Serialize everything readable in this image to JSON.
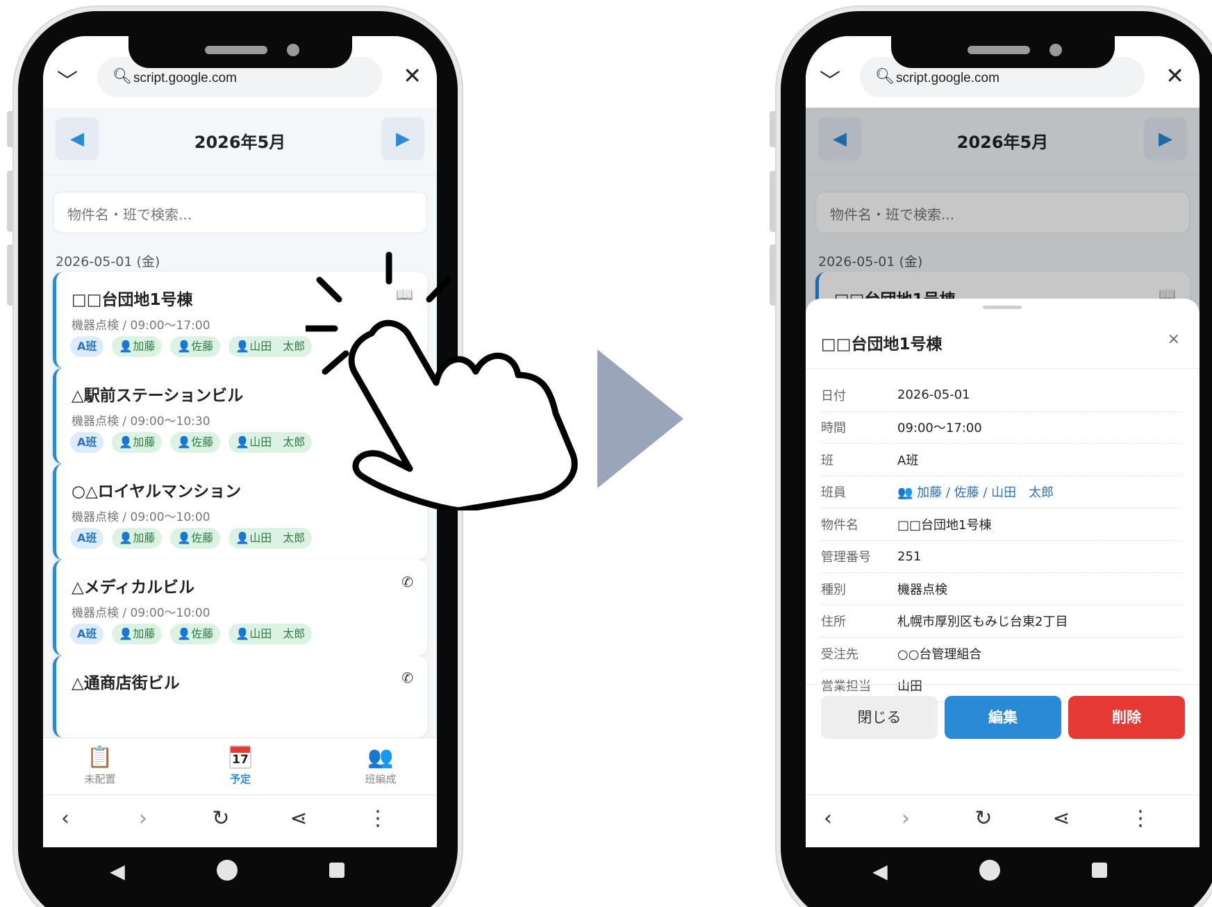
{
  "browser": {
    "url": "script.google.com"
  },
  "calendar": {
    "month_label": "2026年5月",
    "prev_icon": "triangle-left-icon",
    "next_icon": "triangle-right-icon"
  },
  "search": {
    "placeholder": "物件名・班で検索..."
  },
  "date_header": "2026-05-01 (金)",
  "jobs": [
    {
      "title": "□□台団地1号棟",
      "subtitle": "機器点検 / 09:00〜17:00",
      "team": "A班",
      "members": [
        "加藤",
        "佐藤",
        "山田　太郎"
      ],
      "icons": [
        "book-icon"
      ]
    },
    {
      "title": "△駅前ステーションビル",
      "subtitle": "機器点検 / 09:00〜10:30",
      "team": "A班",
      "members": [
        "加藤",
        "佐藤",
        "山田　太郎"
      ],
      "icons": [
        "phone-icon"
      ]
    },
    {
      "title": "○△ロイヤルマンション",
      "subtitle": "機器点検 / 09:00〜10:00",
      "team": "A班",
      "members": [
        "加藤",
        "佐藤",
        "山田　太郎"
      ],
      "icons": [
        "phone-icon",
        "document-icon"
      ]
    },
    {
      "title": "△メディカルビル",
      "subtitle": "機器点検 / 09:00〜10:00",
      "team": "A班",
      "members": [
        "加藤",
        "佐藤",
        "山田　太郎"
      ],
      "icons": [
        "phone-icon"
      ]
    },
    {
      "title": "△通商店街ビル",
      "icons": [
        "phone-icon"
      ]
    }
  ],
  "app_nav": [
    {
      "label": "未配置",
      "icon": "clipboard-icon",
      "active": false
    },
    {
      "label": "予定",
      "icon": "calendar-icon",
      "icon_text": "17",
      "active": true
    },
    {
      "label": "班編成",
      "icon": "people-icon",
      "active": false
    }
  ],
  "detail": {
    "title": "□□台団地1号棟",
    "close_glyph": "×",
    "rows": [
      {
        "key": "日付",
        "value": "2026-05-01"
      },
      {
        "key": "時間",
        "value": "09:00〜17:00"
      },
      {
        "key": "班",
        "value": "A班"
      },
      {
        "key": "班員",
        "value": "加藤 / 佐藤 / 山田　太郎"
      },
      {
        "key": "物件名",
        "value": "□□台団地1号棟"
      },
      {
        "key": "管理番号",
        "value": "251"
      },
      {
        "key": "種別",
        "value": "機器点検"
      },
      {
        "key": "住所",
        "value": "札幌市厚別区もみじ台東2丁目"
      },
      {
        "key": "受注先",
        "value": "○○台管理組合"
      },
      {
        "key": "営業担当",
        "value": "山田"
      }
    ],
    "buttons": {
      "close": "閉じる",
      "edit": "編集",
      "delete": "削除"
    }
  },
  "colors": {
    "accent": "#2a8ad6",
    "danger": "#e53935",
    "member_bg": "#dcf2e2",
    "team_bg": "#dcecfa",
    "arrow": "#9aa5ba"
  }
}
